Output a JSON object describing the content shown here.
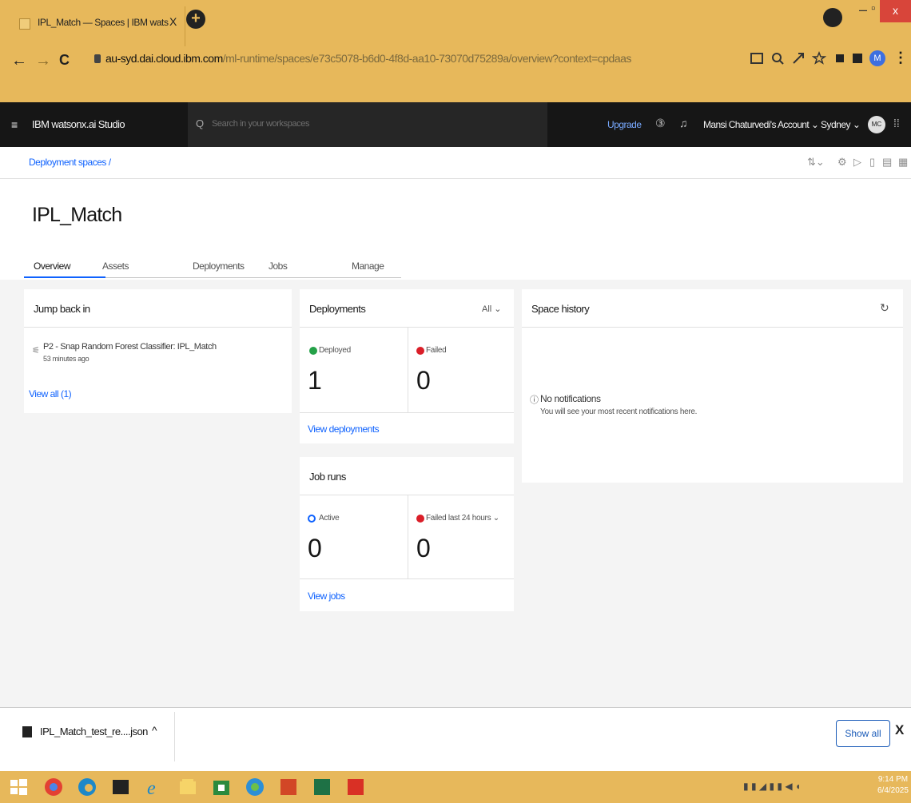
{
  "browser": {
    "tab_title": "IPL_Match — Spaces | IBM wats",
    "tab_close": "X",
    "new_tab": "+",
    "url_domain": "au-syd.dai.cloud.ibm.com",
    "url_path": "/ml-runtime/spaces/e73c5078-b6d0-4f8d-aa10-73070d75289a/overview?context=cpdaas",
    "profile_initial": "M",
    "minimize": "–",
    "maximize": "▫",
    "close": "x"
  },
  "header": {
    "menu_icon": "≡",
    "brand": "IBM watsonx.ai Studio",
    "search_placeholder": "Search in your workspaces",
    "upgrade": "Upgrade",
    "account": "Mansi Chaturvedi's Account ⌄",
    "region": "Sydney ⌄",
    "avatar": "MC"
  },
  "breadcrumb": {
    "label": "Deployment spaces /"
  },
  "page": {
    "title": "IPL_Match"
  },
  "tabs": [
    "Overview",
    "Assets",
    "Deployments",
    "Jobs",
    "Manage"
  ],
  "jump_back": {
    "title": "Jump back in",
    "item_name": "P2 - Snap Random Forest Classifier: IPL_Match",
    "item_time": "53 minutes ago",
    "view_all": "View all (1)"
  },
  "deployments": {
    "title": "Deployments",
    "filter": "All ⌄",
    "deployed_label": "Deployed",
    "deployed_count": "1",
    "failed_label": "Failed",
    "failed_count": "0",
    "view_link": "View deployments"
  },
  "job_runs": {
    "title": "Job runs",
    "active_label": "Active",
    "active_count": "0",
    "failed_label": "Failed last 24 hours ⌄",
    "failed_count": "0",
    "view_link": "View jobs"
  },
  "space_history": {
    "title": "Space history",
    "empty_title": "No notifications",
    "empty_text": "You will see your most recent notifications here."
  },
  "download": {
    "filename": "IPL_Match_test_re....json",
    "show_all": "Show all",
    "close": "X"
  },
  "taskbar": {
    "time": "9:14 PM",
    "date": "6/4/2025"
  },
  "colors": {
    "accent": "#0f62fe",
    "deployed": "#24a148",
    "failed": "#da1e28",
    "window_frame": "#e7b85b"
  }
}
